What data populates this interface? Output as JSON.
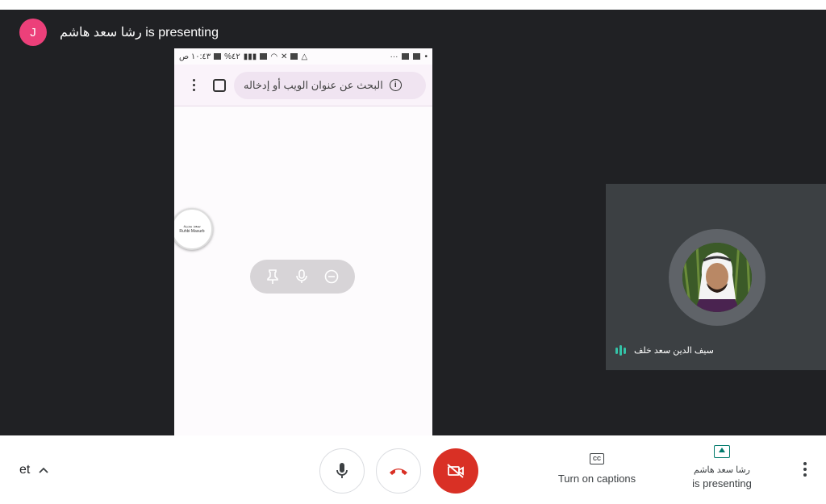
{
  "presenter": {
    "avatar_letter": "J",
    "avatar_color": "#ec407a",
    "banner_text": "رشا سعد هاشم is presenting"
  },
  "shared_screen": {
    "status_bar": {
      "time": "١٠:٤٣ ص",
      "battery": "%٤٢",
      "dots": "···"
    },
    "browser": {
      "address_placeholder": "البحث عن عنوان الويب أو إدخاله",
      "info_glyph": "i"
    },
    "chat_bubble": {
      "line1": "سعد مدينة",
      "line2": "Ruhbi Masurb"
    }
  },
  "participant_tile": {
    "name": "سيف الدين سعد خلف",
    "speaking_color": "#34c3a8"
  },
  "controls": {
    "meeting_details_label": "et",
    "captions_label": "Turn on captions",
    "cc_glyph": "CC",
    "present_name": "رشا سعد هاشم",
    "present_status": "is presenting",
    "end_call_color": "#d93025"
  }
}
